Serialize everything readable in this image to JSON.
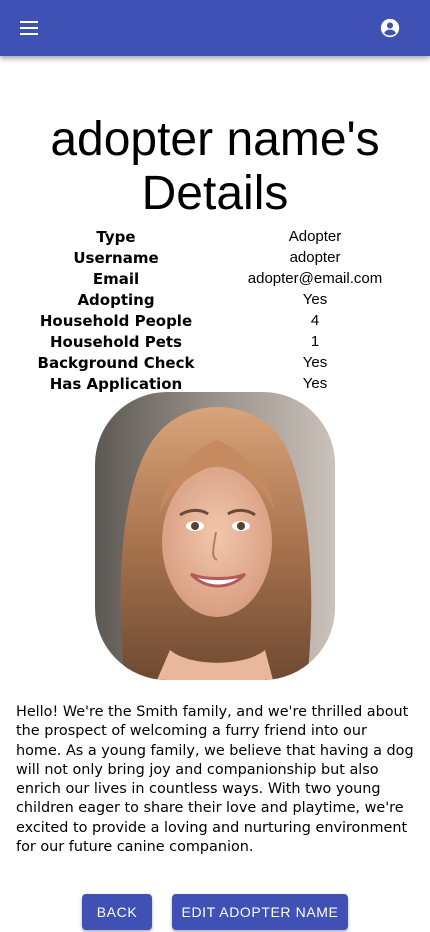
{
  "appbar": {
    "menu_icon": "menu-icon",
    "account_icon": "account-circle-icon",
    "color": "#3f51b5"
  },
  "page": {
    "title": "adopter name's Details"
  },
  "details": [
    {
      "label": "Type",
      "value": "Adopter"
    },
    {
      "label": "Username",
      "value": "adopter"
    },
    {
      "label": "Email",
      "value": "adopter@email.com"
    },
    {
      "label": "Adopting",
      "value": "Yes"
    },
    {
      "label": "Household People",
      "value": "4"
    },
    {
      "label": "Household Pets",
      "value": "1"
    },
    {
      "label": "Background Check",
      "value": "Yes"
    },
    {
      "label": "Has Application",
      "value": "Yes"
    }
  ],
  "bio": "Hello! We're the Smith family, and we're thrilled about the prospect of welcoming a furry friend into our home. As a young family, we believe that having a dog will not only bring joy and companionship but also enrich our lives in countless ways. With two young children eager to share their love and playtime, we're excited to provide a loving and nurturing environment for our future canine companion.",
  "buttons": {
    "back": "BACK",
    "edit": "EDIT ADOPTER NAME"
  }
}
